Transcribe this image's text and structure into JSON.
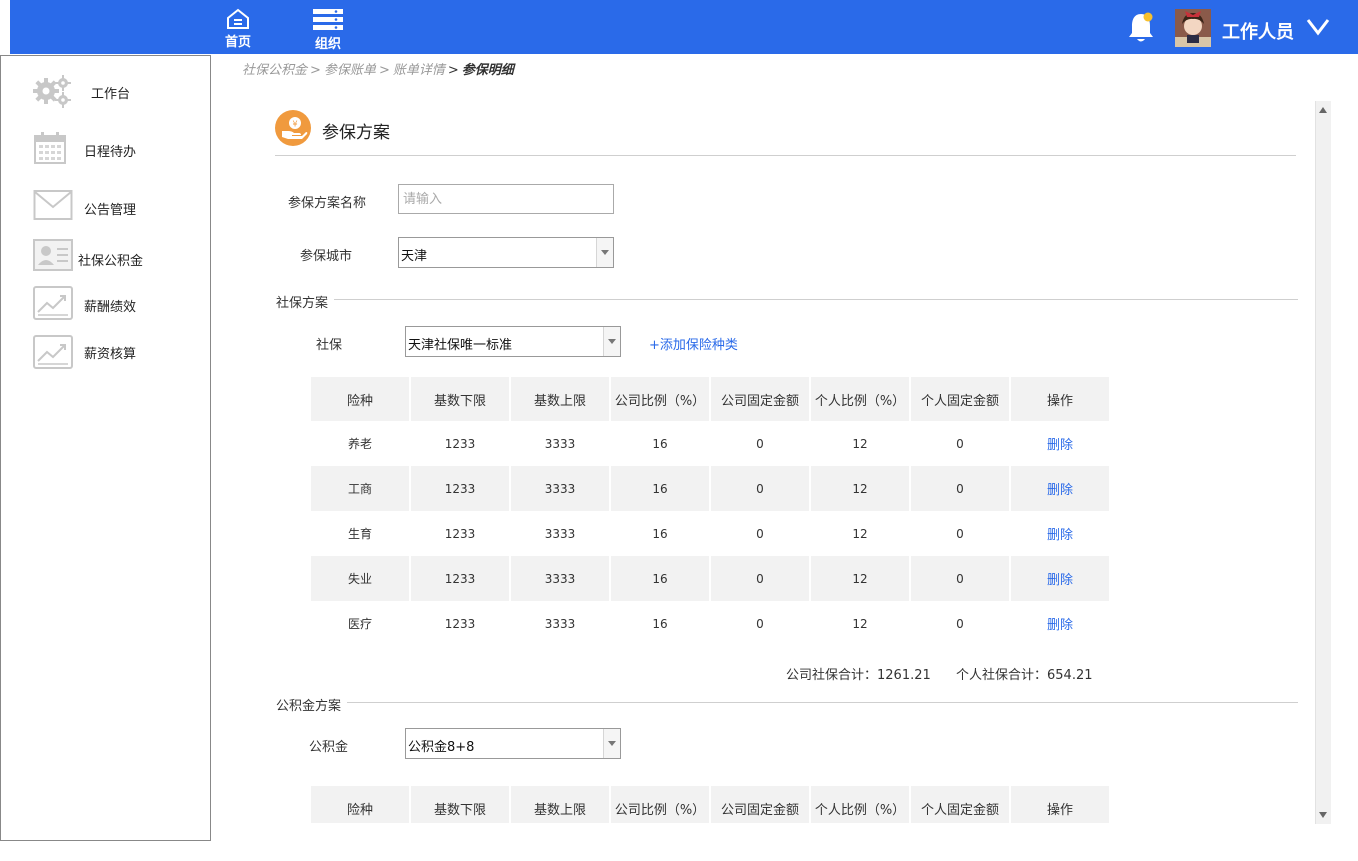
{
  "header": {
    "nav": [
      {
        "label": "首页",
        "icon": "home-icon"
      },
      {
        "label": "组织",
        "icon": "org-icon"
      }
    ],
    "user_name": "工作人员",
    "accent": "#2a6ae9"
  },
  "sidebar": {
    "items": [
      {
        "label": "工作台",
        "icon": "gear-icon"
      },
      {
        "label": "日程待办",
        "icon": "calendar-icon"
      },
      {
        "label": "公告管理",
        "icon": "envelope-icon"
      },
      {
        "label": "社保公积金",
        "icon": "id-card-icon"
      },
      {
        "label": "薪酬绩效",
        "icon": "chart-icon"
      },
      {
        "label": "薪资核算",
        "icon": "chart-icon"
      }
    ]
  },
  "breadcrumb": {
    "items": [
      "社保公积金",
      "参保账单",
      "账单详情",
      "参保明细"
    ],
    "separator": ">"
  },
  "section": {
    "title": "参保方案",
    "plan_name_label": "参保方案名称",
    "plan_name_placeholder": "请输入",
    "city_label": "参保城市",
    "city_value": "天津"
  },
  "social": {
    "group_label": "社保方案",
    "select_label": "社保",
    "select_value": "天津社保唯一标准",
    "add_link": "+添加保险种类",
    "columns": [
      "险种",
      "基数下限",
      "基数上限",
      "公司比例（%）",
      "公司固定金额",
      "个人比例（%）",
      "个人固定金额",
      "操作"
    ],
    "rows": [
      {
        "type": "养老",
        "min": "1233",
        "max": "3333",
        "company_pct": "16",
        "company_fixed": "0",
        "personal_pct": "12",
        "personal_fixed": "0",
        "action": "删除"
      },
      {
        "type": "工商",
        "min": "1233",
        "max": "3333",
        "company_pct": "16",
        "company_fixed": "0",
        "personal_pct": "12",
        "personal_fixed": "0",
        "action": "删除"
      },
      {
        "type": "生育",
        "min": "1233",
        "max": "3333",
        "company_pct": "16",
        "company_fixed": "0",
        "personal_pct": "12",
        "personal_fixed": "0",
        "action": "删除"
      },
      {
        "type": "失业",
        "min": "1233",
        "max": "3333",
        "company_pct": "16",
        "company_fixed": "0",
        "personal_pct": "12",
        "personal_fixed": "0",
        "action": "删除"
      },
      {
        "type": "医疗",
        "min": "1233",
        "max": "3333",
        "company_pct": "16",
        "company_fixed": "0",
        "personal_pct": "12",
        "personal_fixed": "0",
        "action": "删除"
      }
    ],
    "company_total_label": "公司社保合计：",
    "company_total": "1261.21",
    "personal_total_label": "个人社保合计：",
    "personal_total": "654.21"
  },
  "fund": {
    "group_label": "公积金方案",
    "select_label": "公积金",
    "select_value": "公积金8+8",
    "columns": [
      "险种",
      "基数下限",
      "基数上限",
      "公司比例（%）",
      "公司固定金额",
      "个人比例（%）",
      "个人固定金额",
      "操作"
    ]
  }
}
